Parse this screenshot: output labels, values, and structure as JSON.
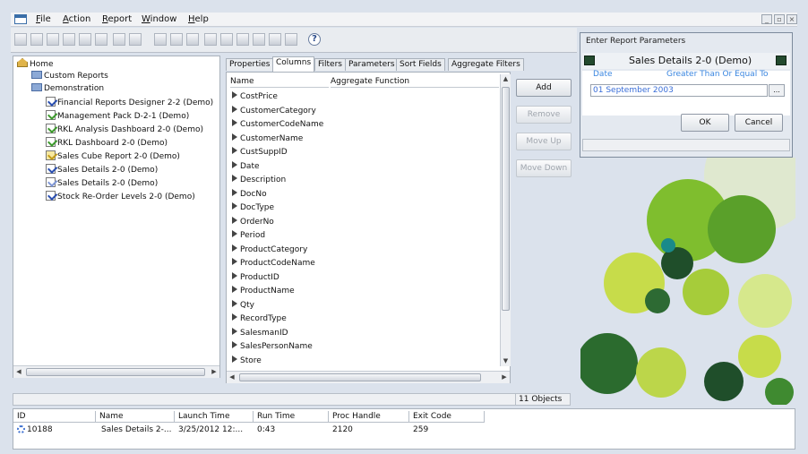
{
  "menu": [
    "File",
    "Action",
    "Report",
    "Window",
    "Help"
  ],
  "toolbar": {
    "help_glyph": "?"
  },
  "tree": [
    {
      "label": "Home",
      "icon": "house"
    },
    {
      "label": "Custom Reports",
      "icon": "folder"
    },
    {
      "label": "Demonstration",
      "icon": "folder"
    },
    {
      "label": "Financial Reports Designer 2-2 (Demo)",
      "icon": "report-blue"
    },
    {
      "label": "Management Pack D-2-1 (Demo)",
      "icon": "report-green"
    },
    {
      "label": "RKL Analysis Dashboard 2-0 (Demo)",
      "icon": "report-green"
    },
    {
      "label": "RKL Dashboard 2-0 (Demo)",
      "icon": "report-green"
    },
    {
      "label": "Sales Cube Report 2-0 (Demo)",
      "icon": "report-yellow"
    },
    {
      "label": "Sales Details 2-0 (Demo)",
      "icon": "report-blue"
    },
    {
      "label": "Sales Details 2-0 (Demo)",
      "icon": "report-light"
    },
    {
      "label": "Stock Re-Order Levels 2-0 (Demo)",
      "icon": "report-blue"
    }
  ],
  "tabs": [
    "Properties",
    "Columns",
    "Filters",
    "Parameters",
    "Sort Fields",
    "Aggregate Filters"
  ],
  "active_tab": "Columns",
  "columns_list": {
    "headers": [
      "Name",
      "Aggregate Function"
    ],
    "rows": [
      "CostPrice",
      "CustomerCategory",
      "CustomerCodeName",
      "CustomerName",
      "CustSuppID",
      "Date",
      "Description",
      "DocNo",
      "DocType",
      "OrderNo",
      "Period",
      "ProductCategory",
      "ProductCodeName",
      "ProductID",
      "ProductName",
      "Qty",
      "RecordType",
      "SalesmanID",
      "SalesPersonName",
      "Store"
    ]
  },
  "actions": {
    "add": "Add",
    "remove": "Remove",
    "move_up": "Move Up",
    "move_down": "Move Down"
  },
  "status": {
    "objects": "11 Objects"
  },
  "dialog": {
    "title": "Enter Report Parameters",
    "report_name": "Sales Details 2-0 (Demo)",
    "param_label": "Date",
    "param_operator": "Greater Than Or Equal To",
    "param_value": "01 September 2003",
    "ellipsis": "...",
    "ok": "OK",
    "cancel": "Cancel"
  },
  "jobs": {
    "headers": [
      "ID",
      "Name",
      "Launch Time",
      "Run Time",
      "Proc Handle",
      "Exit Code"
    ],
    "rows": [
      {
        "id": "10188",
        "name": "Sales Details 2-...",
        "launch": "3/25/2012 12:...",
        "run": "0:43",
        "proc": "2120",
        "exit": "259"
      }
    ]
  },
  "colors": {
    "accent_green": "#7fbe2e",
    "dark_green": "#1f4e2a",
    "link_blue": "#3a86e0"
  }
}
